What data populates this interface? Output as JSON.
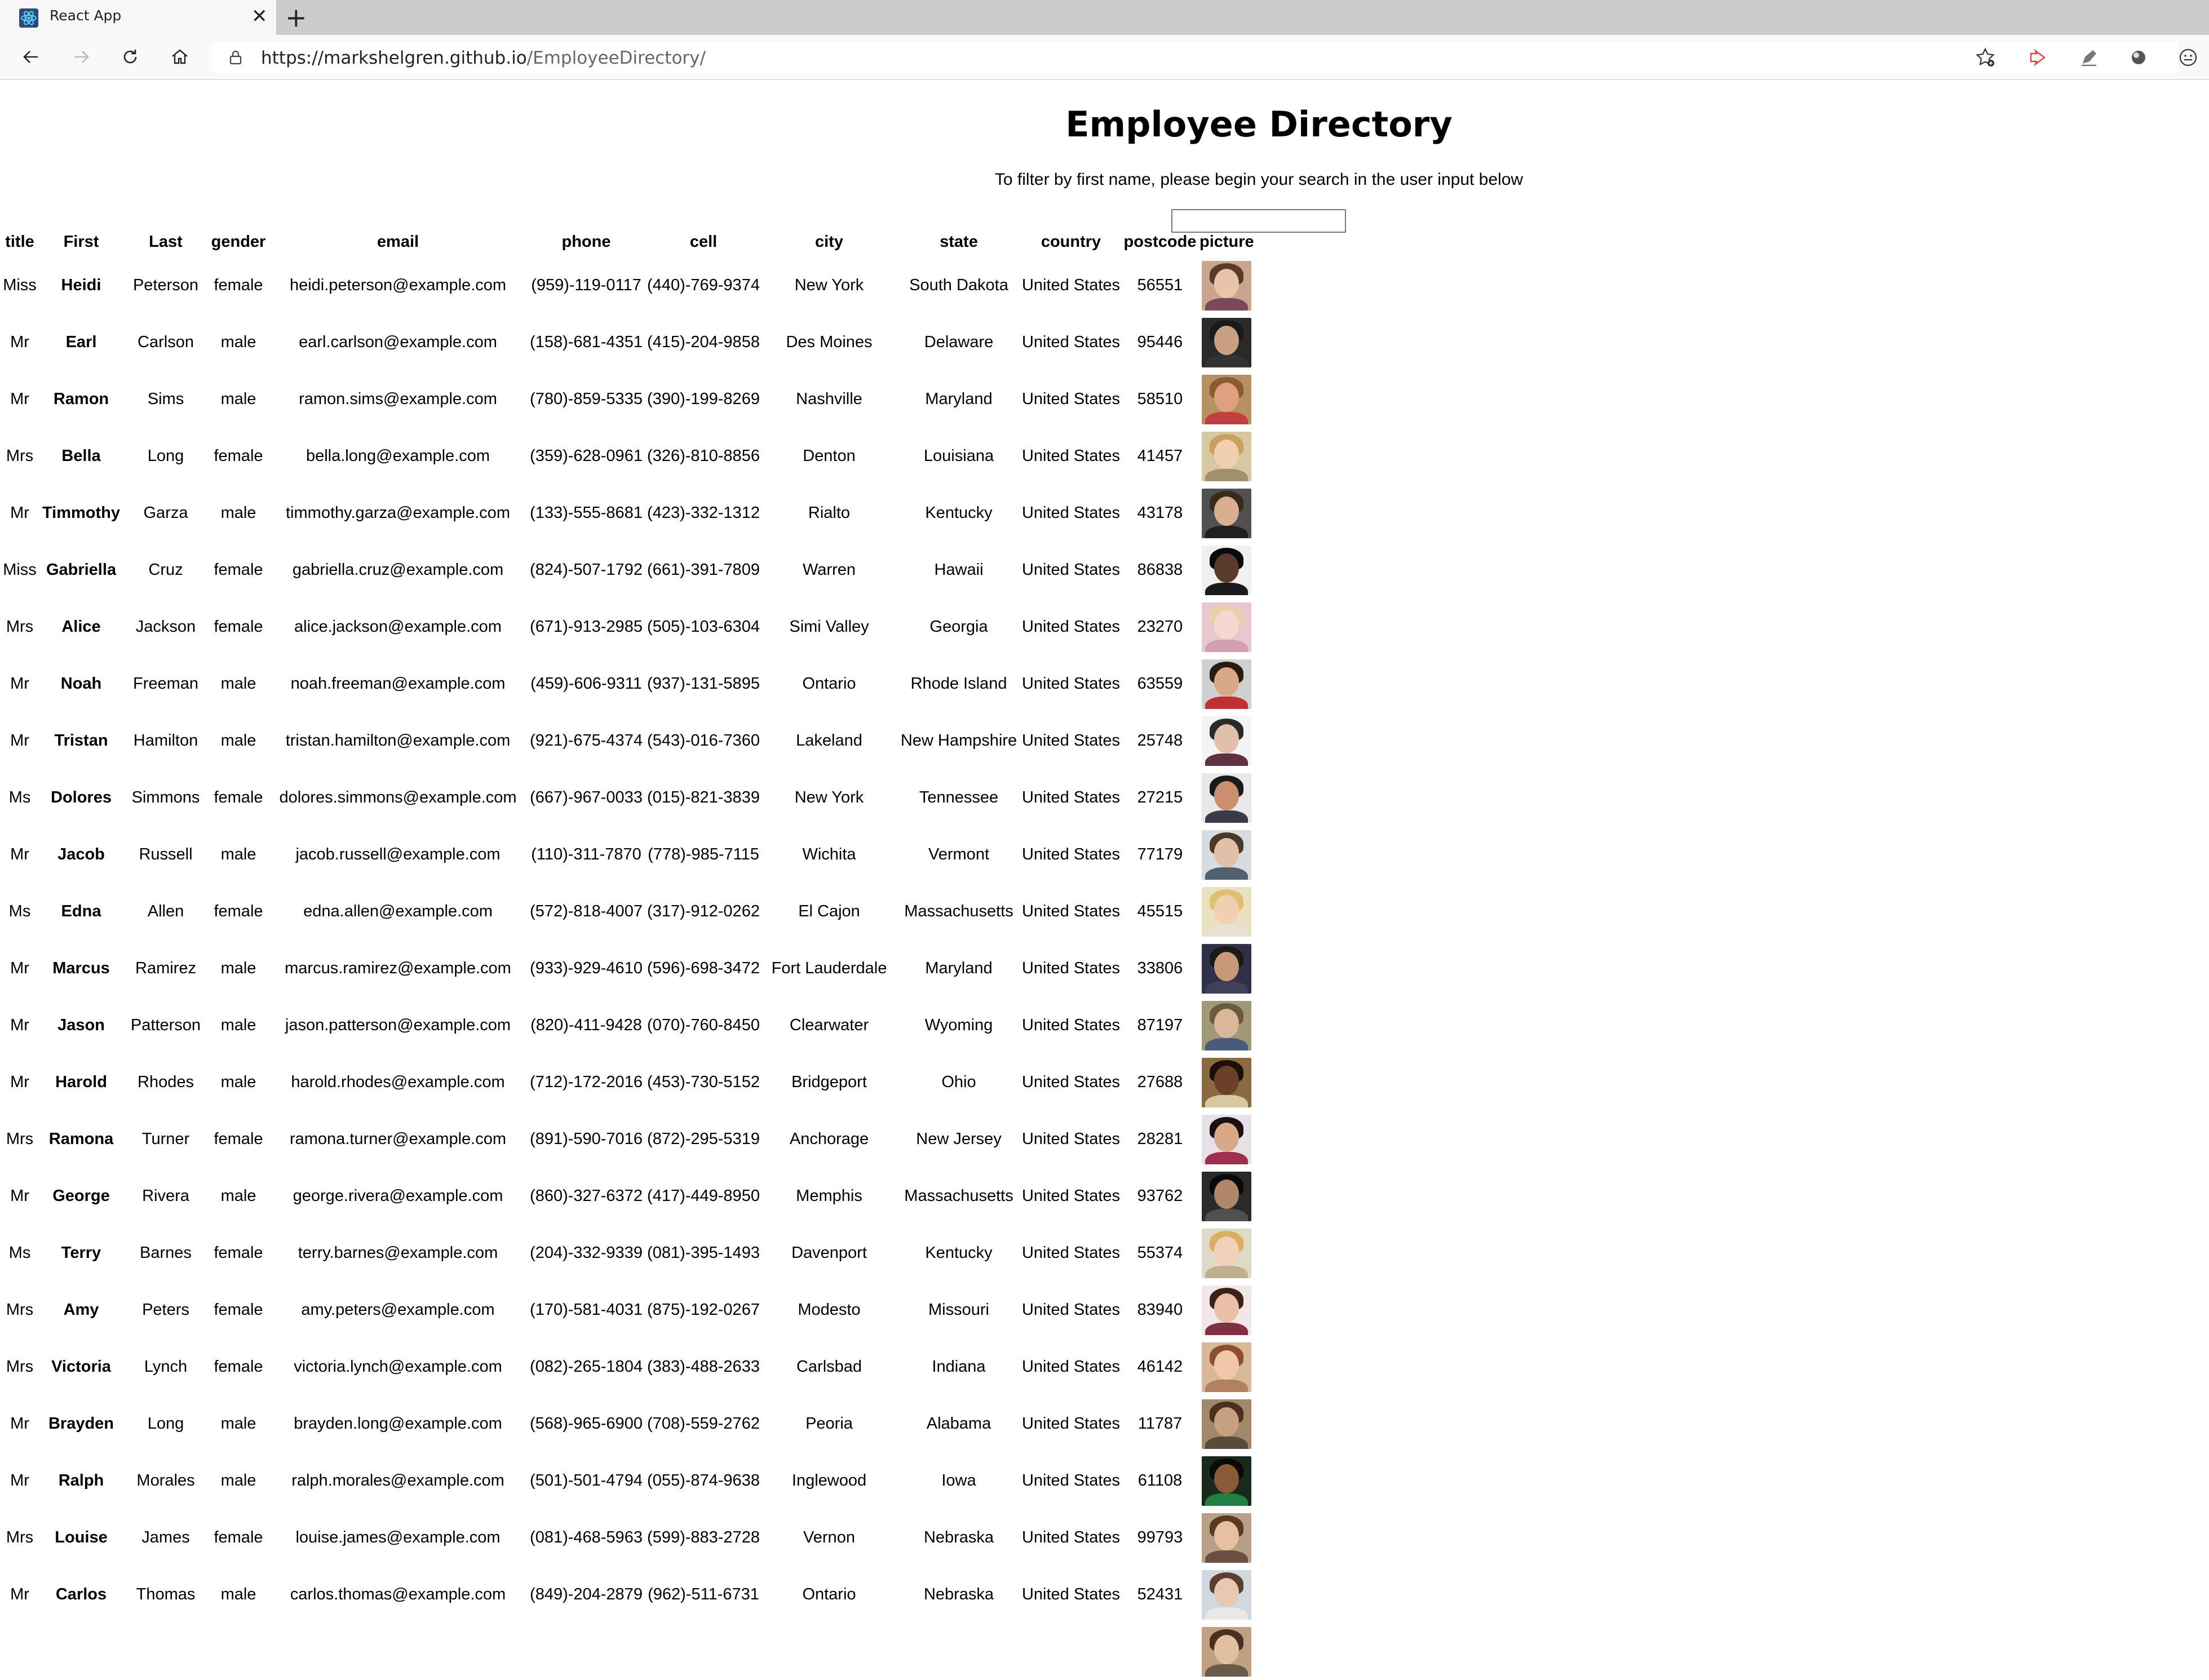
{
  "browser": {
    "tab_title": "React App",
    "url_host": "https://markshelgren.github.io",
    "url_path": "/EmployeeDirectory/"
  },
  "page": {
    "heading": "Employee Directory",
    "instructions": "To filter by first name, please begin your search in the user input below",
    "filter_value": ""
  },
  "table": {
    "columns": [
      "title",
      "First",
      "Last",
      "gender",
      "email",
      "phone",
      "cell",
      "city",
      "state",
      "country",
      "postcode",
      "picture"
    ],
    "rows": [
      {
        "title": "Miss",
        "first": "Heidi",
        "last": "Peterson",
        "gender": "female",
        "email": "heidi.peterson@example.com",
        "phone": "(959)-119-0117",
        "cell": "(440)-769-9374",
        "city": "New York",
        "state": "South Dakota",
        "country": "United States",
        "postcode": "56551",
        "avatar": {
          "bg": "#c9a58e",
          "skin": "#e8c4a8",
          "hair": "#5a3a2a",
          "shirt": "#7a4a5a"
        }
      },
      {
        "title": "Mr",
        "first": "Earl",
        "last": "Carlson",
        "gender": "male",
        "email": "earl.carlson@example.com",
        "phone": "(158)-681-4351",
        "cell": "(415)-204-9858",
        "city": "Des Moines",
        "state": "Delaware",
        "country": "United States",
        "postcode": "95446",
        "avatar": {
          "bg": "#2a2a2a",
          "skin": "#c9a080",
          "hair": "#1a1a1a",
          "shirt": "#333333"
        }
      },
      {
        "title": "Mr",
        "first": "Ramon",
        "last": "Sims",
        "gender": "male",
        "email": "ramon.sims@example.com",
        "phone": "(780)-859-5335",
        "cell": "(390)-199-8269",
        "city": "Nashville",
        "state": "Maryland",
        "country": "United States",
        "postcode": "58510",
        "avatar": {
          "bg": "#b59060",
          "skin": "#e0a080",
          "hair": "#8a5a30",
          "shirt": "#c04040"
        }
      },
      {
        "title": "Mrs",
        "first": "Bella",
        "last": "Long",
        "gender": "female",
        "email": "bella.long@example.com",
        "phone": "(359)-628-0961",
        "cell": "(326)-810-8856",
        "city": "Denton",
        "state": "Louisiana",
        "country": "United States",
        "postcode": "41457",
        "avatar": {
          "bg": "#d8c8a0",
          "skin": "#f0d0b0",
          "hair": "#c8a060",
          "shirt": "#a09070"
        }
      },
      {
        "title": "Mr",
        "first": "Timmothy",
        "last": "Garza",
        "gender": "male",
        "email": "timmothy.garza@example.com",
        "phone": "(133)-555-8681",
        "cell": "(423)-332-1312",
        "city": "Rialto",
        "state": "Kentucky",
        "country": "United States",
        "postcode": "43178",
        "avatar": {
          "bg": "#505050",
          "skin": "#d8b090",
          "hair": "#3a2a1a",
          "shirt": "#202020"
        }
      },
      {
        "title": "Miss",
        "first": "Gabriella",
        "last": "Cruz",
        "gender": "female",
        "email": "gabriella.cruz@example.com",
        "phone": "(824)-507-1792",
        "cell": "(661)-391-7809",
        "city": "Warren",
        "state": "Hawaii",
        "country": "United States",
        "postcode": "86838",
        "avatar": {
          "bg": "#f0f0f0",
          "skin": "#5a3a2a",
          "hair": "#0a0a0a",
          "shirt": "#1a1a1a"
        }
      },
      {
        "title": "Mrs",
        "first": "Alice",
        "last": "Jackson",
        "gender": "female",
        "email": "alice.jackson@example.com",
        "phone": "(671)-913-2985",
        "cell": "(505)-103-6304",
        "city": "Simi Valley",
        "state": "Georgia",
        "country": "United States",
        "postcode": "23270",
        "avatar": {
          "bg": "#e8c8d0",
          "skin": "#f5d8d0",
          "hair": "#e8d0a8",
          "shirt": "#d0a0b0"
        }
      },
      {
        "title": "Mr",
        "first": "Noah",
        "last": "Freeman",
        "gender": "male",
        "email": "noah.freeman@example.com",
        "phone": "(459)-606-9311",
        "cell": "(937)-131-5895",
        "city": "Ontario",
        "state": "Rhode Island",
        "country": "United States",
        "postcode": "63559",
        "avatar": {
          "bg": "#d0d0d0",
          "skin": "#d8a888",
          "hair": "#2a1a10",
          "shirt": "#c03030"
        }
      },
      {
        "title": "Mr",
        "first": "Tristan",
        "last": "Hamilton",
        "gender": "male",
        "email": "tristan.hamilton@example.com",
        "phone": "(921)-675-4374",
        "cell": "(543)-016-7360",
        "city": "Lakeland",
        "state": "New Hampshire",
        "country": "United States",
        "postcode": "25748",
        "avatar": {
          "bg": "#f4f4f4",
          "skin": "#e0c0a8",
          "hair": "#2a2a2a",
          "shirt": "#603040"
        }
      },
      {
        "title": "Ms",
        "first": "Dolores",
        "last": "Simmons",
        "gender": "female",
        "email": "dolores.simmons@example.com",
        "phone": "(667)-967-0033",
        "cell": "(015)-821-3839",
        "city": "New York",
        "state": "Tennessee",
        "country": "United States",
        "postcode": "27215",
        "avatar": {
          "bg": "#e8e8e8",
          "skin": "#c89070",
          "hair": "#1a1a1a",
          "shirt": "#3a3a4a"
        }
      },
      {
        "title": "Mr",
        "first": "Jacob",
        "last": "Russell",
        "gender": "male",
        "email": "jacob.russell@example.com",
        "phone": "(110)-311-7870",
        "cell": "(778)-985-7115",
        "city": "Wichita",
        "state": "Vermont",
        "country": "United States",
        "postcode": "77179",
        "avatar": {
          "bg": "#d8dce0",
          "skin": "#e0c0a8",
          "hair": "#4a3a2a",
          "shirt": "#506070"
        }
      },
      {
        "title": "Ms",
        "first": "Edna",
        "last": "Allen",
        "gender": "female",
        "email": "edna.allen@example.com",
        "phone": "(572)-818-4007",
        "cell": "(317)-912-0262",
        "city": "El Cajon",
        "state": "Massachusetts",
        "country": "United States",
        "postcode": "45515",
        "avatar": {
          "bg": "#e8e0c0",
          "skin": "#f0d0b0",
          "hair": "#e0c070",
          "shirt": "#e8e0d0"
        }
      },
      {
        "title": "Mr",
        "first": "Marcus",
        "last": "Ramirez",
        "gender": "male",
        "email": "marcus.ramirez@example.com",
        "phone": "(933)-929-4610",
        "cell": "(596)-698-3472",
        "city": "Fort Lauderdale",
        "state": "Maryland",
        "country": "United States",
        "postcode": "33806",
        "avatar": {
          "bg": "#303048",
          "skin": "#c89878",
          "hair": "#1a1a1a",
          "shirt": "#404058"
        }
      },
      {
        "title": "Mr",
        "first": "Jason",
        "last": "Patterson",
        "gender": "male",
        "email": "jason.patterson@example.com",
        "phone": "(820)-411-9428",
        "cell": "(070)-760-8450",
        "city": "Clearwater",
        "state": "Wyoming",
        "country": "United States",
        "postcode": "87197",
        "avatar": {
          "bg": "#a09878",
          "skin": "#d8b898",
          "hair": "#6a5a40",
          "shirt": "#4a5a7a"
        }
      },
      {
        "title": "Mr",
        "first": "Harold",
        "last": "Rhodes",
        "gender": "male",
        "email": "harold.rhodes@example.com",
        "phone": "(712)-172-2016",
        "cell": "(453)-730-5152",
        "city": "Bridgeport",
        "state": "Ohio",
        "country": "United States",
        "postcode": "27688",
        "avatar": {
          "bg": "#8a6a40",
          "skin": "#6a4028",
          "hair": "#1a1008",
          "shirt": "#d8c8a0"
        }
      },
      {
        "title": "Mrs",
        "first": "Ramona",
        "last": "Turner",
        "gender": "female",
        "email": "ramona.turner@example.com",
        "phone": "(891)-590-7016",
        "cell": "(872)-295-5319",
        "city": "Anchorage",
        "state": "New Jersey",
        "country": "United States",
        "postcode": "28281",
        "avatar": {
          "bg": "#e8e0e8",
          "skin": "#d8a888",
          "hair": "#1a1010",
          "shirt": "#a03050"
        }
      },
      {
        "title": "Mr",
        "first": "George",
        "last": "Rivera",
        "gender": "male",
        "email": "george.rivera@example.com",
        "phone": "(860)-327-6372",
        "cell": "(417)-449-8950",
        "city": "Memphis",
        "state": "Massachusetts",
        "country": "United States",
        "postcode": "93762",
        "avatar": {
          "bg": "#2a2a2a",
          "skin": "#b08868",
          "hair": "#0a0a0a",
          "shirt": "#505050"
        }
      },
      {
        "title": "Ms",
        "first": "Terry",
        "last": "Barnes",
        "gender": "female",
        "email": "terry.barnes@example.com",
        "phone": "(204)-332-9339",
        "cell": "(081)-395-1493",
        "city": "Davenport",
        "state": "Kentucky",
        "country": "United States",
        "postcode": "55374",
        "avatar": {
          "bg": "#e0d8c8",
          "skin": "#f0d0b8",
          "hair": "#d8b060",
          "shirt": "#c0b090"
        }
      },
      {
        "title": "Mrs",
        "first": "Amy",
        "last": "Peters",
        "gender": "female",
        "email": "amy.peters@example.com",
        "phone": "(170)-581-4031",
        "cell": "(875)-192-0267",
        "city": "Modesto",
        "state": "Missouri",
        "country": "United States",
        "postcode": "83940",
        "avatar": {
          "bg": "#f0e8e8",
          "skin": "#e8c0a8",
          "hair": "#3a2018",
          "shirt": "#803040"
        }
      },
      {
        "title": "Mrs",
        "first": "Victoria",
        "last": "Lynch",
        "gender": "female",
        "email": "victoria.lynch@example.com",
        "phone": "(082)-265-1804",
        "cell": "(383)-488-2633",
        "city": "Carlsbad",
        "state": "Indiana",
        "country": "United States",
        "postcode": "46142",
        "avatar": {
          "bg": "#d8b898",
          "skin": "#f0c8a8",
          "hair": "#8a5030",
          "shirt": "#b08060"
        }
      },
      {
        "title": "Mr",
        "first": "Brayden",
        "last": "Long",
        "gender": "male",
        "email": "brayden.long@example.com",
        "phone": "(568)-965-6900",
        "cell": "(708)-559-2762",
        "city": "Peoria",
        "state": "Alabama",
        "country": "United States",
        "postcode": "11787",
        "avatar": {
          "bg": "#a08868",
          "skin": "#c8a080",
          "hair": "#4a3020",
          "shirt": "#5a4a3a"
        }
      },
      {
        "title": "Mr",
        "first": "Ralph",
        "last": "Morales",
        "gender": "male",
        "email": "ralph.morales@example.com",
        "phone": "(501)-501-4794",
        "cell": "(055)-874-9638",
        "city": "Inglewood",
        "state": "Iowa",
        "country": "United States",
        "postcode": "61108",
        "avatar": {
          "bg": "#1a2a1a",
          "skin": "#8a5a38",
          "hair": "#0a0a0a",
          "shirt": "#208040"
        }
      },
      {
        "title": "Mrs",
        "first": "Louise",
        "last": "James",
        "gender": "female",
        "email": "louise.james@example.com",
        "phone": "(081)-468-5963",
        "cell": "(599)-883-2728",
        "city": "Vernon",
        "state": "Nebraska",
        "country": "United States",
        "postcode": "99793",
        "avatar": {
          "bg": "#b8a088",
          "skin": "#e8c0a0",
          "hair": "#5a3a20",
          "shirt": "#6a5040"
        }
      },
      {
        "title": "Mr",
        "first": "Carlos",
        "last": "Thomas",
        "gender": "male",
        "email": "carlos.thomas@example.com",
        "phone": "(849)-204-2879",
        "cell": "(962)-511-6731",
        "city": "Ontario",
        "state": "Nebraska",
        "country": "United States",
        "postcode": "52431",
        "avatar": {
          "bg": "#d0d8e0",
          "skin": "#e8c8b0",
          "hair": "#5a4030",
          "shirt": "#e8e8e8"
        }
      },
      {
        "title": "",
        "first": "",
        "last": "",
        "gender": "",
        "email": "",
        "phone": "",
        "cell": "",
        "city": "",
        "state": "",
        "country": "",
        "postcode": "",
        "avatar": {
          "bg": "#c0a080",
          "skin": "#e0c0a0",
          "hair": "#4a3020",
          "shirt": "#6a5a4a"
        }
      }
    ]
  }
}
